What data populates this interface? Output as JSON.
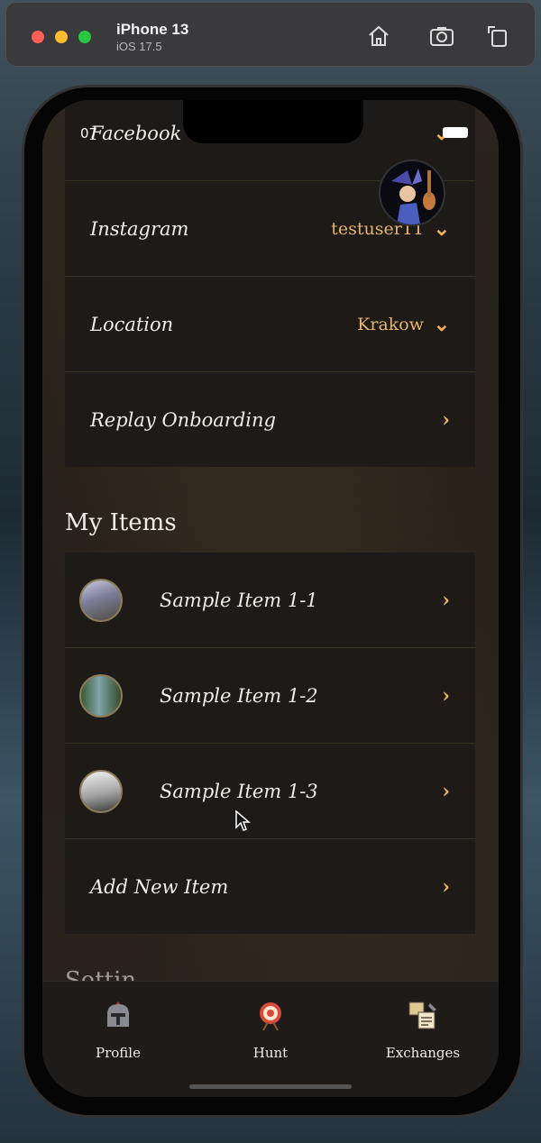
{
  "simulator": {
    "device": "iPhone 13",
    "os": "iOS 17.5",
    "buttons": [
      "home-icon",
      "screenshot-icon",
      "rotate-icon"
    ]
  },
  "status": {
    "time": "07"
  },
  "social": [
    {
      "label": "Facebook",
      "value": ""
    },
    {
      "label": "Instagram",
      "value": "testuser11"
    },
    {
      "label": "Location",
      "value": "Krakow"
    },
    {
      "label": "Replay Onboarding",
      "value": ""
    }
  ],
  "items_section": {
    "title": "My Items",
    "items": [
      {
        "label": "Sample Item 1-1"
      },
      {
        "label": "Sample Item 1-2"
      },
      {
        "label": "Sample Item 1-3"
      }
    ],
    "add_label": "Add New Item"
  },
  "settings_peek": "Settin",
  "tabbar": {
    "tabs": [
      {
        "label": "Profile",
        "icon": "helmet-icon"
      },
      {
        "label": "Hunt",
        "icon": "target-icon"
      },
      {
        "label": "Exchanges",
        "icon": "scroll-icon"
      }
    ]
  },
  "colors": {
    "accent": "#f0b05d",
    "card": "#1d1a17",
    "text": "#f1ede6"
  }
}
